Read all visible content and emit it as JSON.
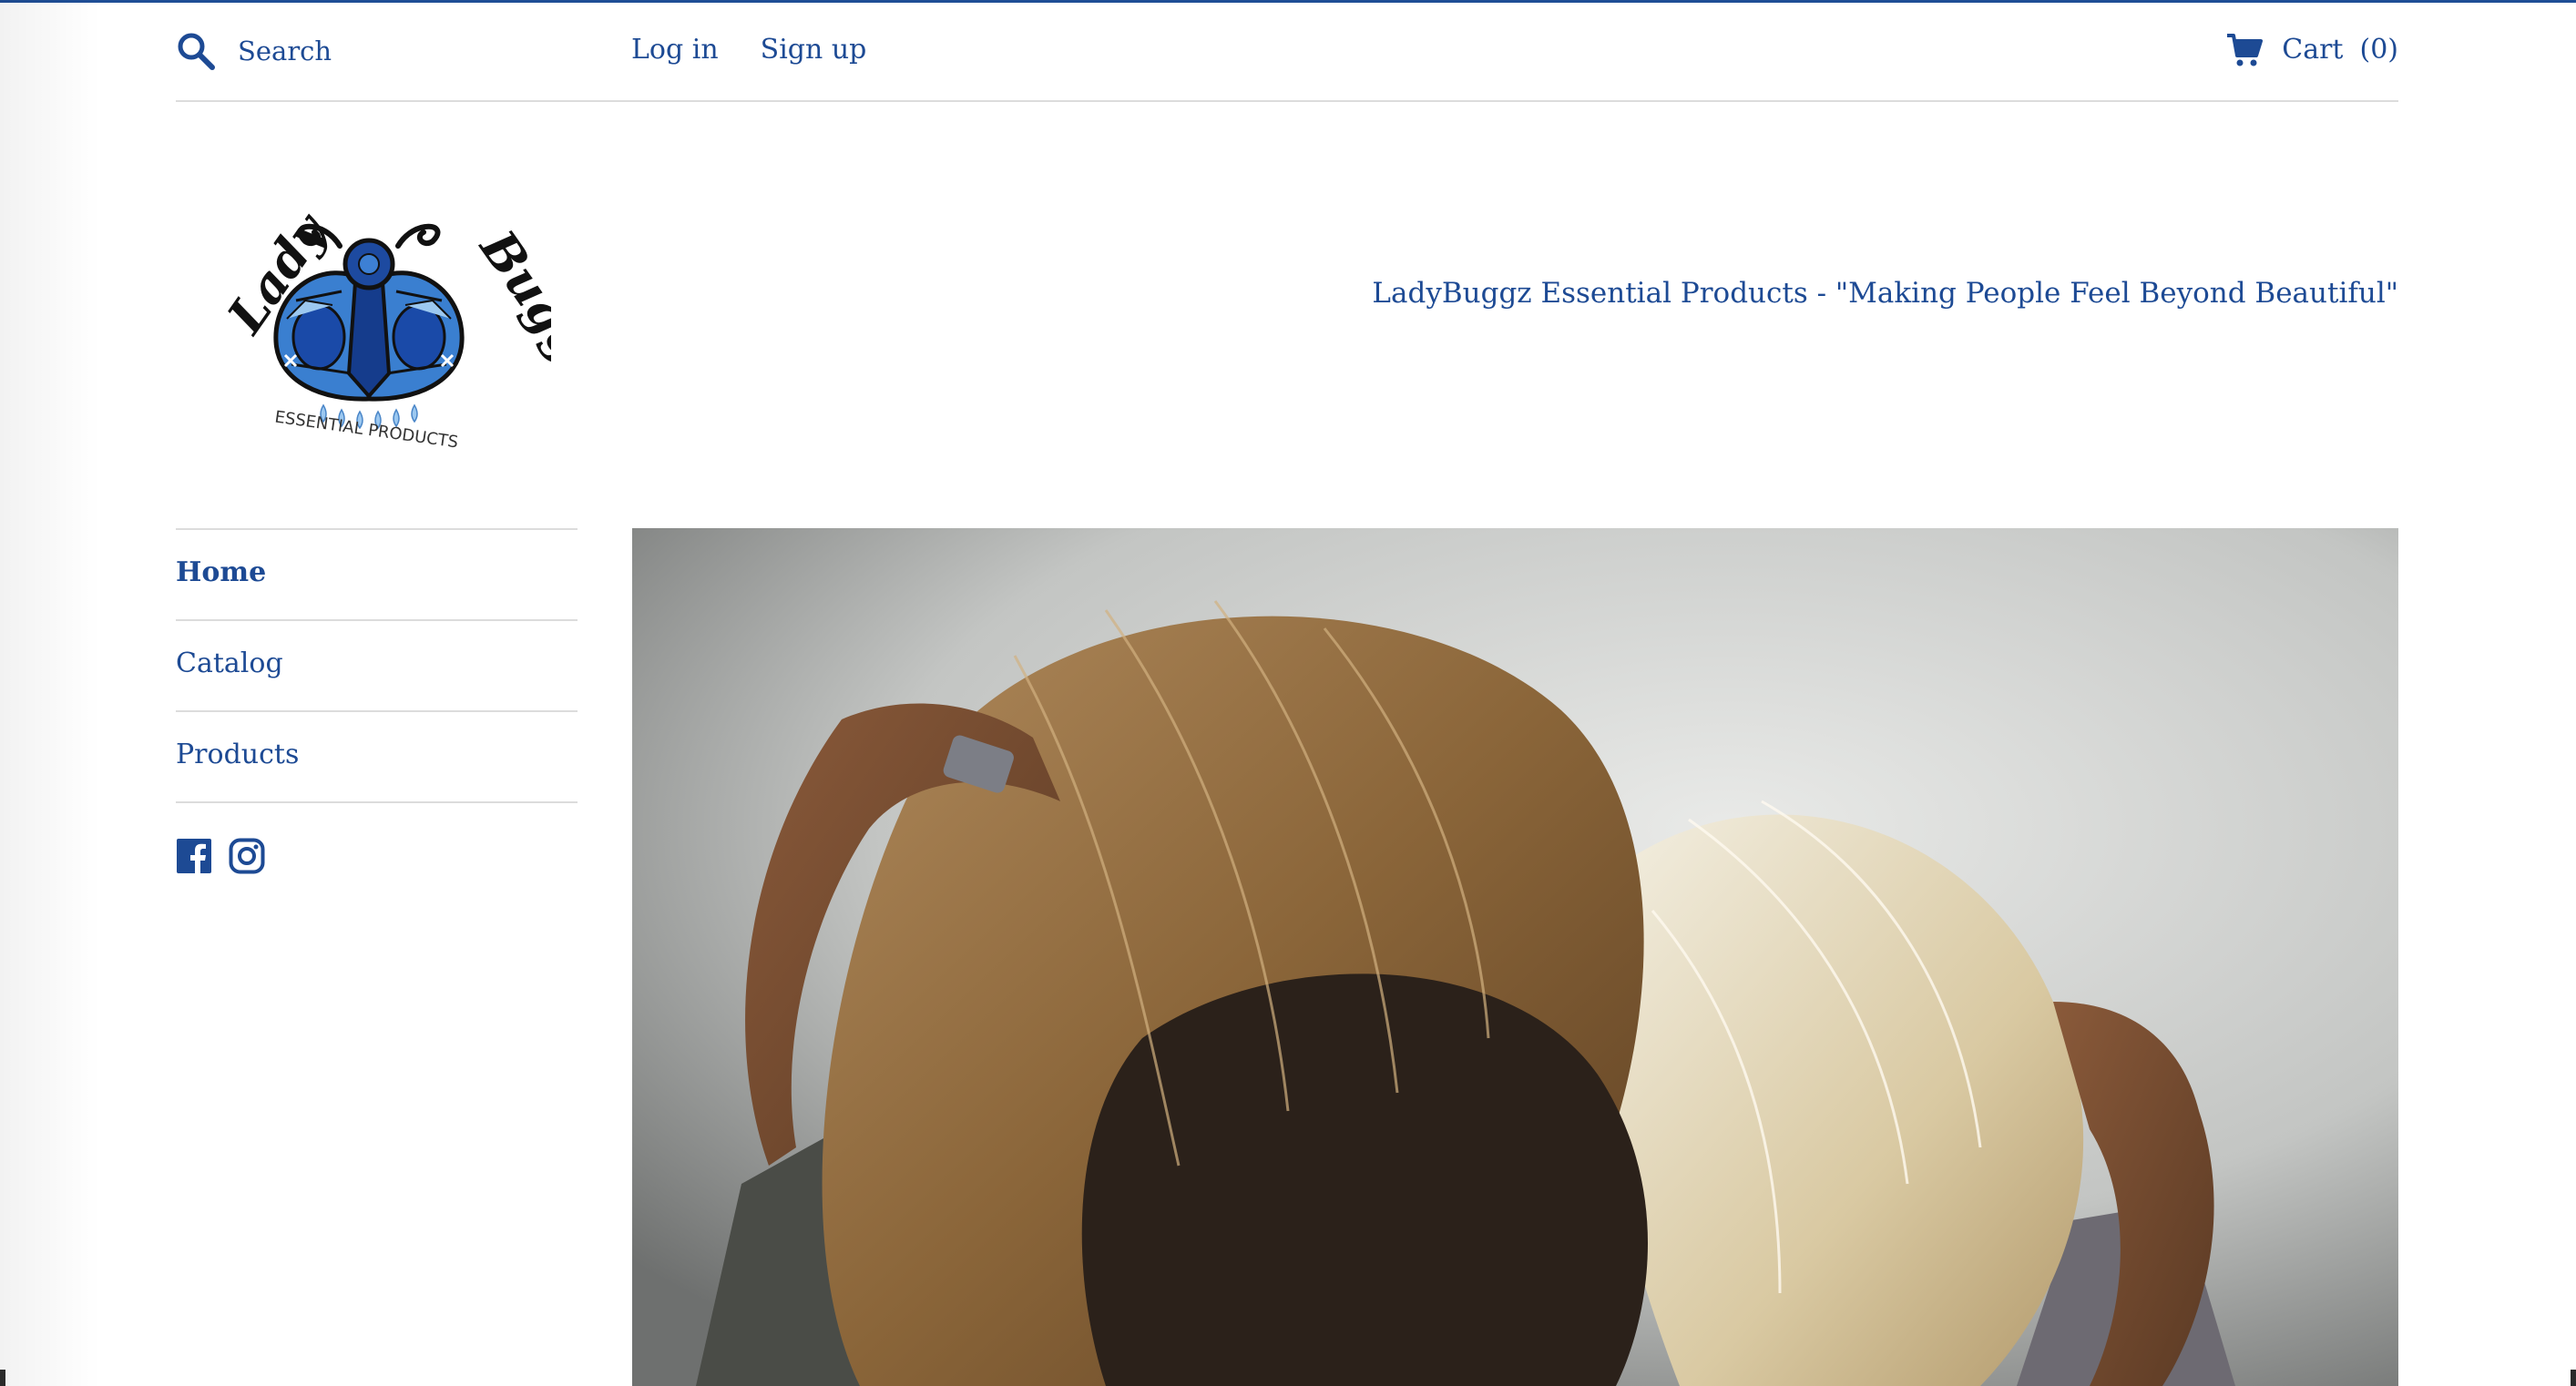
{
  "header": {
    "search": {
      "placeholder": "Search"
    },
    "auth": {
      "login_label": "Log in",
      "signup_label": "Sign up"
    },
    "cart": {
      "label": "Cart",
      "count": "(0)"
    }
  },
  "brand": {
    "logo_text_top": "Lady Buggz",
    "logo_text_bottom": "ESSENTIAL PRODUCTS",
    "tagline": "LadyBuggz Essential Products - \"Making People Feel Beyond Beautiful\""
  },
  "sidebar": {
    "items": [
      {
        "label": "Home",
        "active": true
      },
      {
        "label": "Catalog",
        "active": false
      },
      {
        "label": "Products",
        "active": false
      }
    ],
    "social": [
      "facebook-icon",
      "instagram-icon"
    ]
  },
  "hero": {
    "icon": "hero-image"
  },
  "colors": {
    "accent": "#1d4a94",
    "divider": "#dcdcdc"
  }
}
